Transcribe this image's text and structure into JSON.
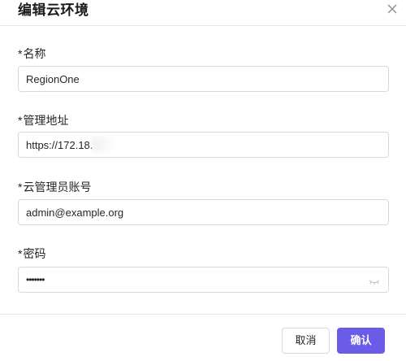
{
  "dialog": {
    "title": "编辑云环境",
    "close_icon": "close-icon"
  },
  "fields": {
    "name": {
      "required_mark": "*",
      "label": "名称",
      "value": "RegionOne"
    },
    "address": {
      "required_mark": "*",
      "label": "管理地址",
      "value": "https://172.18."
    },
    "account": {
      "required_mark": "*",
      "label": "云管理员账号",
      "value": "admin@example.org"
    },
    "password": {
      "required_mark": "*",
      "label": "密码",
      "value": "•••••••",
      "toggle_icon": "eye-closed-icon"
    }
  },
  "footer": {
    "cancel_label": "取消",
    "ok_label": "确认"
  },
  "colors": {
    "accent": "#6b5ce7",
    "border": "#d9d9d9",
    "divider": "#e8e8e8"
  }
}
